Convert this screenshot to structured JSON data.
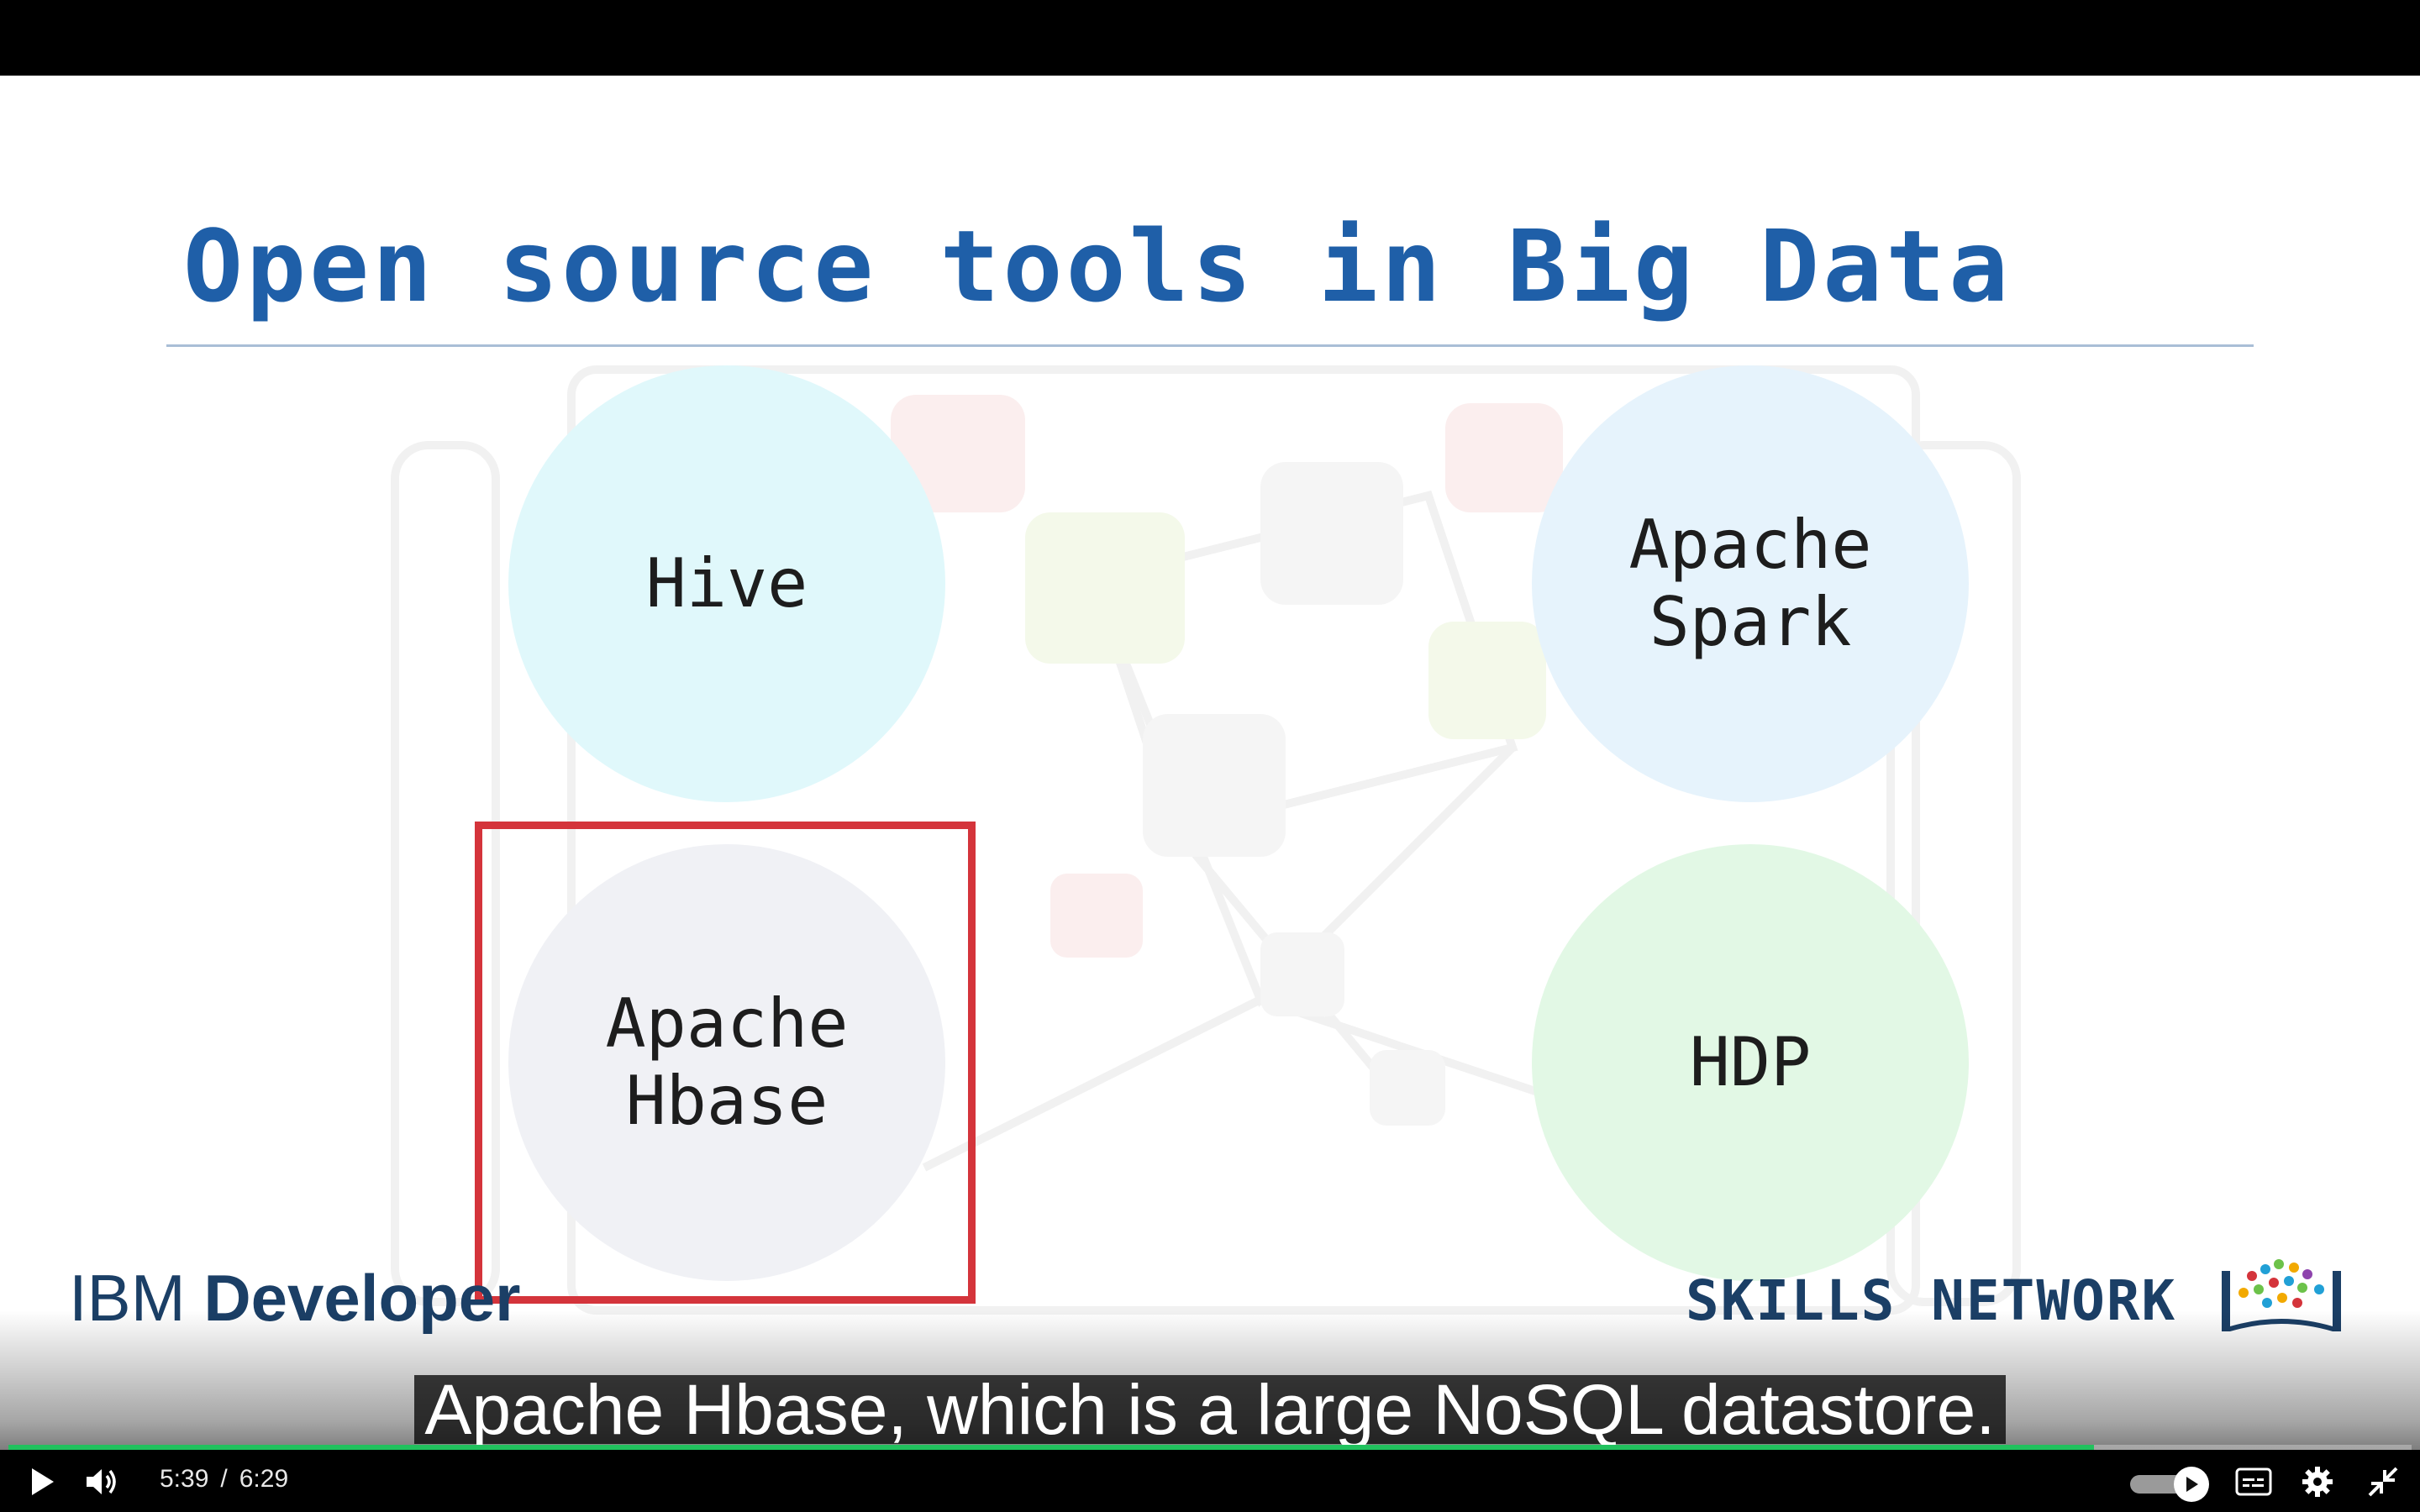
{
  "slide": {
    "title": "Open source tools in Big Data",
    "tools": [
      {
        "label": "Hive",
        "color": "#e0f8fb"
      },
      {
        "label": "Apache\nSpark",
        "color": "#e6f3fc"
      },
      {
        "label": "Apache\nHbase",
        "color": "#f0f1f5",
        "highlighted": true
      },
      {
        "label": "HDP",
        "color": "#e2f8e5"
      }
    ],
    "highlight_color": "#d4343b",
    "brand_left_light": "IBM ",
    "brand_left_bold": "Developer",
    "brand_right": "SKILLS NETWORK",
    "title_color": "#1f5fa8"
  },
  "caption": "Apache Hbase, which is a large NoSQL datastore.",
  "player": {
    "current_time": "5:39",
    "separator": "/",
    "duration": "6:29",
    "progress_fraction": 0.868,
    "progress_color": "#21c25e",
    "autoplay_on": true,
    "icons": [
      "play-icon",
      "volume-icon",
      "autoplay-icon",
      "captions-icon",
      "settings-gear-icon",
      "exit-fullscreen-icon"
    ]
  }
}
